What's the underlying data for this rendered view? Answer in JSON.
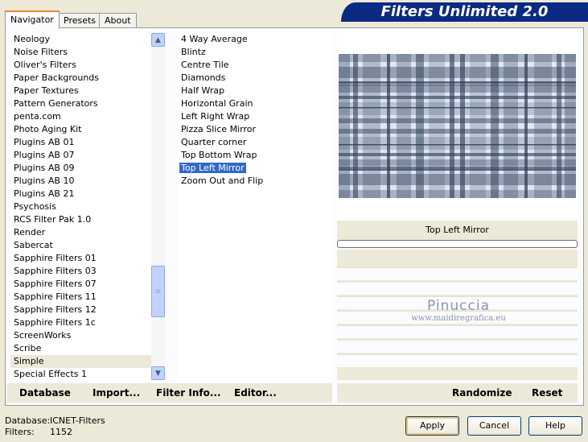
{
  "app": {
    "title": "Filters Unlimited 2.0"
  },
  "tabs": [
    {
      "label": "Navigator",
      "active": true
    },
    {
      "label": "Presets",
      "active": false
    },
    {
      "label": "About",
      "active": false
    }
  ],
  "categories": {
    "items": [
      "Neology",
      "Noise Filters",
      "Oliver's Filters",
      "Paper Backgrounds",
      "Paper Textures",
      "Pattern Generators",
      "penta.com",
      "Photo Aging Kit",
      "Plugins AB 01",
      "Plugins AB 07",
      "Plugins AB 09",
      "Plugins AB 10",
      "Plugins AB 21",
      "Psychosis",
      "RCS Filter Pak 1.0",
      "Render",
      "Sabercat",
      "Sapphire Filters 01",
      "Sapphire Filters 03",
      "Sapphire Filters 07",
      "Sapphire Filters 11",
      "Sapphire Filters 12",
      "Sapphire Filters 1c",
      "ScreenWorks",
      "Scribe",
      "Simple",
      "Special Effects 1"
    ],
    "selected": "Simple"
  },
  "filters": {
    "items": [
      "4 Way Average",
      "Blintz",
      "Centre Tile",
      "Diamonds",
      "Half Wrap",
      "Horizontal Grain",
      "Left Right Wrap",
      "Pizza Slice Mirror",
      "Quarter corner",
      "Top Bottom Wrap",
      "Top Left Mirror",
      "Zoom Out and Flip"
    ],
    "selected": "Top Left Mirror"
  },
  "preview": {
    "filter_name": "Top Left Mirror",
    "watermark_line1": "Pinuccia",
    "watermark_line2": "www.maidiregrafica.eu"
  },
  "toolbar": {
    "database_label": "Database",
    "import_label": "Import...",
    "filter_info_label": "Filter Info...",
    "editor_label": "Editor...",
    "randomize_label": "Randomize",
    "reset_label": "Reset"
  },
  "footer": {
    "database_label": "Database:",
    "database_value": "ICNET-Filters",
    "filters_label": "Filters:",
    "filters_value": "1152",
    "apply_label": "Apply",
    "cancel_label": "Cancel",
    "help_label": "Help"
  },
  "colors": {
    "banner": "#0a2a83",
    "selection": "#316ac5",
    "preview_dark": "#2a3a52",
    "preview_light": "#dfe6f5"
  }
}
